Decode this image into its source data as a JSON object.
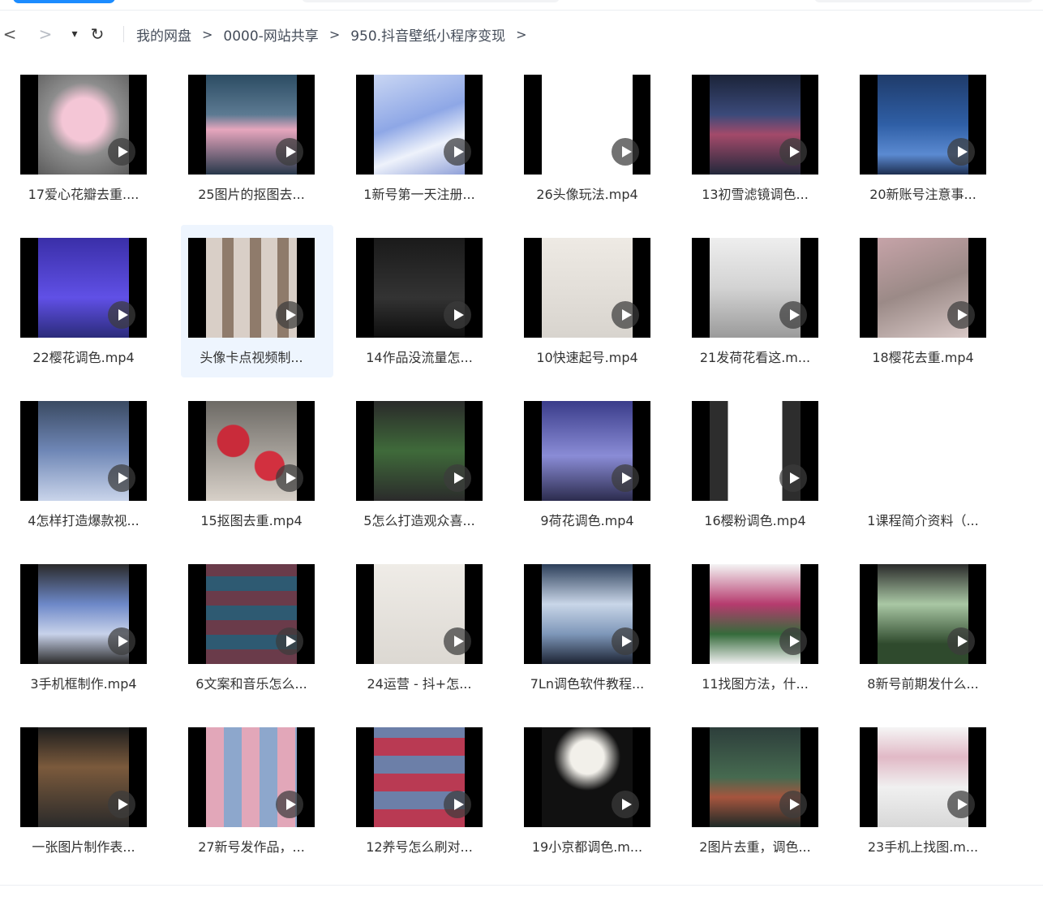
{
  "nav": {
    "back_icon": "<",
    "forward_icon": ">",
    "dropdown_icon": "▾",
    "refresh_icon": "↻"
  },
  "breadcrumb": {
    "items": [
      "我的网盘",
      "0000-网站共享",
      "950.抖音壁纸小程序变现"
    ],
    "separator": ">"
  },
  "files": [
    {
      "name": "17爱心花瓣去重....",
      "thumb": "c-pink"
    },
    {
      "name": "25图片的抠图去...",
      "thumb": "c-roseblue"
    },
    {
      "name": "1新号第一天注册...",
      "thumb": "c-lavender"
    },
    {
      "name": "26头像玩法.mp4",
      "thumb": "c-white"
    },
    {
      "name": "13初雪滤镜调色...",
      "thumb": "c-navy"
    },
    {
      "name": "20新账号注意事...",
      "thumb": "c-water"
    },
    {
      "name": "22樱花调色.mp4",
      "thumb": "c-violet"
    },
    {
      "name": "头像卡点视频制...",
      "thumb": "c-grid",
      "selected": true
    },
    {
      "name": "14作品没流量怎...",
      "thumb": "c-dark"
    },
    {
      "name": "10快速起号.mp4",
      "thumb": "c-paper"
    },
    {
      "name": "21发荷花看这.m...",
      "thumb": "c-tablet"
    },
    {
      "name": "18樱花去重.mp4",
      "thumb": "c-wall"
    },
    {
      "name": "4怎样打造爆款视...",
      "thumb": "c-phone"
    },
    {
      "name": "15抠图去重.mp4",
      "thumb": "c-redrose"
    },
    {
      "name": "5怎么打造观众喜...",
      "thumb": "c-field"
    },
    {
      "name": "9荷花调色.mp4",
      "thumb": "c-lotus"
    },
    {
      "name": "16樱粉调色.mp4",
      "thumb": "c-door"
    },
    {
      "name": "1课程简介资料（...",
      "thumb": "c-doc",
      "document": true
    },
    {
      "name": "3手机框制作.mp4",
      "thumb": "c-case"
    },
    {
      "name": "6文案和音乐怎么...",
      "thumb": "c-mosaic"
    },
    {
      "name": "24运营 - 抖+怎...",
      "thumb": "c-note"
    },
    {
      "name": "7Ln调色软件教程...",
      "thumb": "c-flowers"
    },
    {
      "name": "11找图方法，什...",
      "thumb": "c-pinkbush"
    },
    {
      "name": "8新号前期发什么...",
      "thumb": "c-greenphone"
    },
    {
      "name": "一张图片制作表...",
      "thumb": "c-brown"
    },
    {
      "name": "27新号发作品，...",
      "thumb": "c-gallery"
    },
    {
      "name": "12养号怎么刷对...",
      "thumb": "c-redgrid"
    },
    {
      "name": "19小京都调色.m...",
      "thumb": "c-blackrose"
    },
    {
      "name": "2图片去重，调色...",
      "thumb": "c-garden"
    },
    {
      "name": "23手机上找图.m...",
      "thumb": "c-ui"
    }
  ]
}
